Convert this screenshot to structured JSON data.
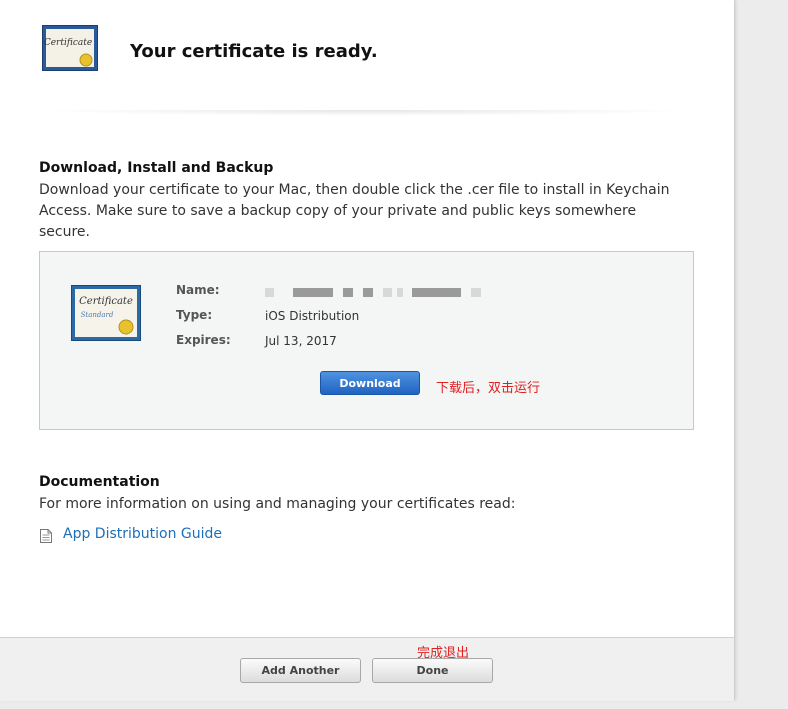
{
  "header": {
    "title": "Your certificate is ready."
  },
  "download_section": {
    "title": "Download, Install and Backup",
    "text": "Download your certificate to your Mac, then double click the .cer file to install in Keychain Access. Make sure to save a backup copy of your private and public keys somewhere secure."
  },
  "certificate": {
    "name_label": "Name:",
    "type_label": "Type:",
    "type_value": "iOS Distribution",
    "expires_label": "Expires:",
    "expires_value": "Jul 13, 2017",
    "icon_title": "Certificate",
    "icon_subtitle": "Standard",
    "download_label": "Download",
    "download_annotation": "下载后，双击运行"
  },
  "documentation": {
    "title": "Documentation",
    "text": "For more information on using and managing your certificates read:",
    "link_label": "App Distribution Guide"
  },
  "footer": {
    "add_another_label": "Add Another",
    "done_label": "Done",
    "done_annotation": "完成退出"
  },
  "colors": {
    "accent": "#1d6fb8",
    "annotation": "#e02020",
    "button_blue": "#2f78d4"
  }
}
